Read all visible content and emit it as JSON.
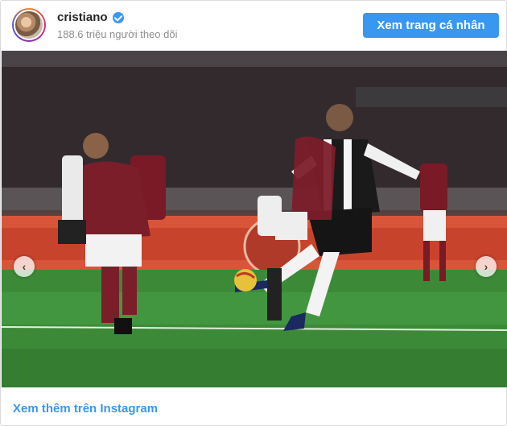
{
  "header": {
    "username": "cristiano",
    "followers": "188.6 triệu người theo dõi",
    "profile_button": "Xem trang cá nhân"
  },
  "carousel": {
    "slide_count": 4,
    "active_slide": 3
  },
  "footer": {
    "more_link": "Xem thêm trên Instagram"
  },
  "colors": {
    "accent": "#3897f0",
    "verified": "#3897f0"
  },
  "icons": [
    "verified-badge-icon",
    "chevron-left-icon",
    "chevron-right-icon"
  ]
}
